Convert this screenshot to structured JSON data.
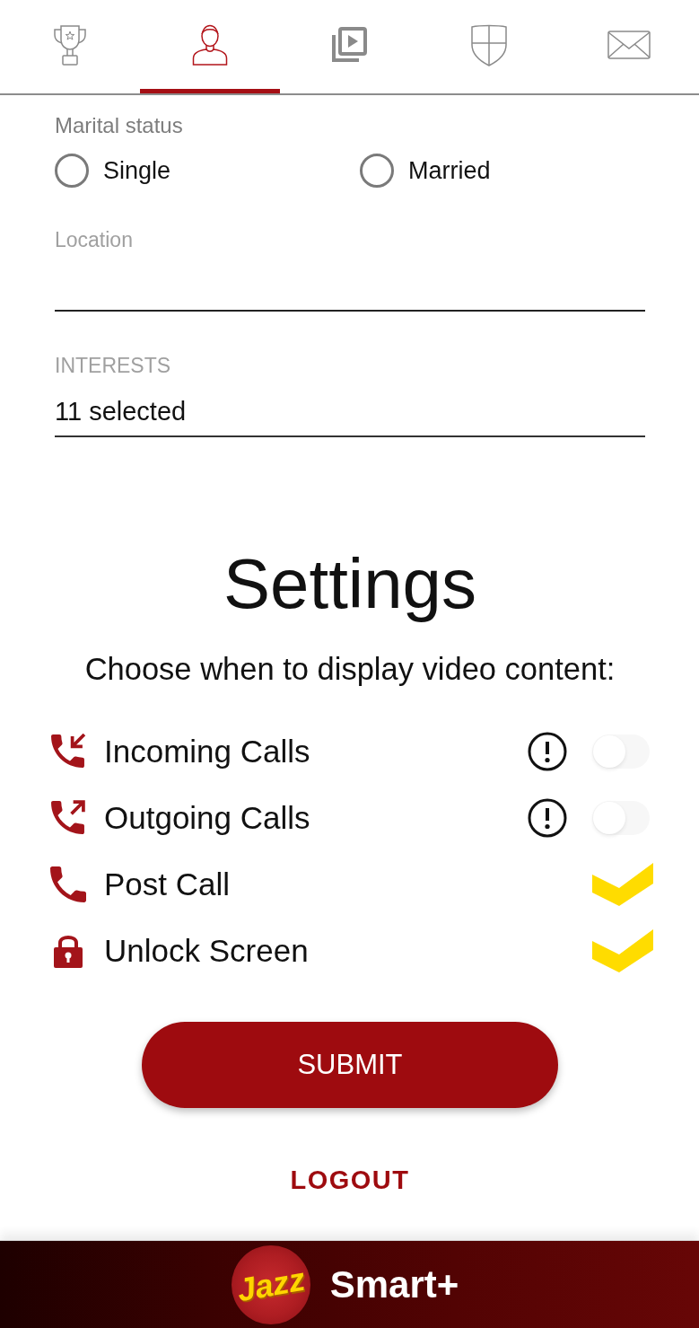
{
  "tabs": [
    {
      "kind": "trophy",
      "selected": false
    },
    {
      "kind": "profile",
      "selected": true
    },
    {
      "kind": "videos",
      "selected": false
    },
    {
      "kind": "shield",
      "selected": false
    },
    {
      "kind": "mail",
      "selected": false
    }
  ],
  "profile": {
    "marital_status": {
      "label": "Marital status",
      "options": [
        {
          "label": "Single",
          "selected": false
        },
        {
          "label": "Married",
          "selected": false
        }
      ]
    },
    "location": {
      "label": "Location"
    },
    "interests": {
      "label": "INTERESTS",
      "value": "11 selected"
    }
  },
  "settings": {
    "title": "Settings",
    "subtitle": "Choose when to display video content:",
    "items": [
      {
        "kind": "incoming",
        "label": "Incoming Calls",
        "warning": true,
        "on": false
      },
      {
        "kind": "outgoing",
        "label": "Outgoing Calls",
        "warning": true,
        "on": false
      },
      {
        "kind": "call",
        "label": "Post Call",
        "warning": false,
        "on": true
      },
      {
        "kind": "unlock",
        "label": "Unlock Screen",
        "warning": false,
        "on": true
      }
    ]
  },
  "submit_button": "SUBMIT",
  "logout_link": "LOGOUT",
  "footer": {
    "logo": "Jazz",
    "brand": "Smart+"
  }
}
